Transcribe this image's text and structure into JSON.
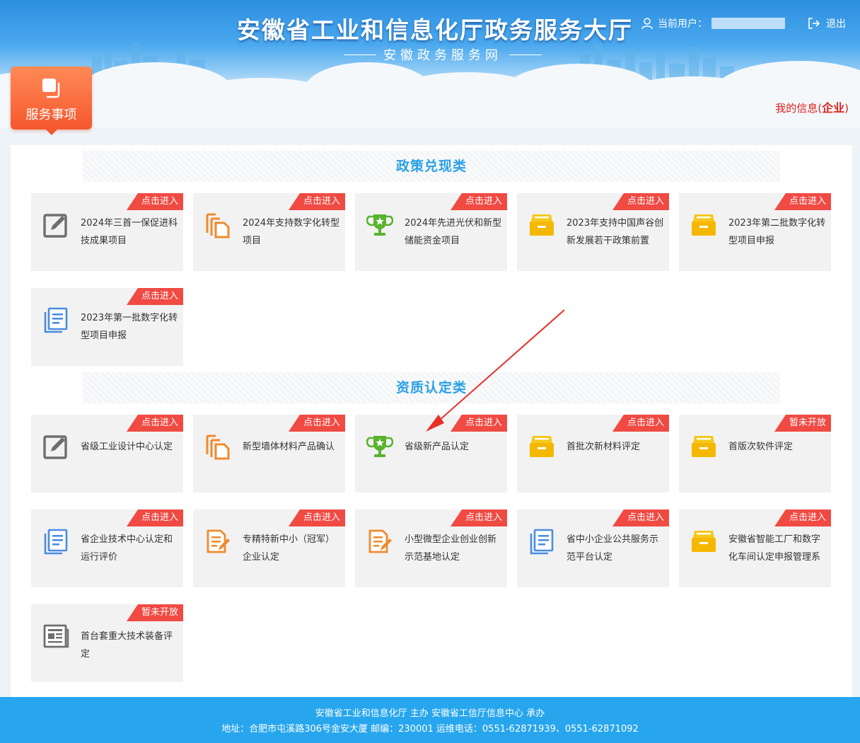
{
  "header": {
    "title": "安徽省工业和信息化厅政务服务大厅",
    "subtitle": "安徽政务服务网",
    "user_label": "当前用户：",
    "logout_label": "退出"
  },
  "nav": {
    "service_tab_label": "服务事项",
    "my_info_prefix": "我的信息(",
    "my_info_type": "企业",
    "my_info_suffix": ")"
  },
  "sections": [
    {
      "title": "政策兑现类",
      "cards": [
        {
          "title": "2024年三首一保促进科技成果项目",
          "badge": "点击进入",
          "icon": "edit-icon"
        },
        {
          "title": "2024年支持数字化转型项目",
          "badge": "点击进入",
          "icon": "copy-docs-icon"
        },
        {
          "title": "2024年先进光伏和新型储能资金项目",
          "badge": "点击进入",
          "icon": "trophy-icon"
        },
        {
          "title": "2023年支持中国声谷创新发展若干政策前置",
          "badge": "点击进入",
          "icon": "drawer-icon"
        },
        {
          "title": "2023年第二批数字化转型项目申报",
          "badge": "点击进入",
          "icon": "drawer-icon"
        },
        {
          "title": "2023年第一批数字化转型项目申报",
          "badge": "点击进入",
          "icon": "document-list-icon"
        }
      ]
    },
    {
      "title": "资质认定类",
      "cards": [
        {
          "title": "省级工业设计中心认定",
          "badge": "点击进入",
          "icon": "edit-icon"
        },
        {
          "title": "新型墙体材料产品确认",
          "badge": "点击进入",
          "icon": "copy-docs-icon"
        },
        {
          "title": "省级新产品认定",
          "badge": "点击进入",
          "icon": "trophy-icon"
        },
        {
          "title": "首批次新材料评定",
          "badge": "点击进入",
          "icon": "drawer-icon"
        },
        {
          "title": "首版次软件评定",
          "badge": "暂未开放",
          "icon": "drawer-icon"
        },
        {
          "title": "省企业技术中心认定和运行评价",
          "badge": "点击进入",
          "icon": "document-list-icon"
        },
        {
          "title": "专精特新中小（冠军）企业认定",
          "badge": "点击进入",
          "icon": "document-pen-icon"
        },
        {
          "title": "小型微型企业创业创新示范基地认定",
          "badge": "点击进入",
          "icon": "document-pen-icon"
        },
        {
          "title": "省中小企业公共服务示范平台认定",
          "badge": "点击进入",
          "icon": "document-list-icon"
        },
        {
          "title": "安徽省智能工厂和数字化车间认定申报管理系",
          "badge": "点击进入",
          "icon": "drawer-icon"
        },
        {
          "title": "首台套重大技术装备评定",
          "badge": "暂未开放",
          "icon": "newspaper-icon"
        }
      ]
    }
  ],
  "footer": {
    "line1": "安徽省工业和信息化厅 主办   安徽省工信厅信息中心 承办",
    "line2": "地址：合肥市屯溪路306号金安大厦 邮编：230001 运维电话：0551-62871939、0551-62871092"
  },
  "colors": {
    "accent_blue": "#2aa0e6",
    "badge_red": "#f04a43",
    "tab_orange": "#f5572d",
    "footer_blue": "#27a6ee"
  }
}
